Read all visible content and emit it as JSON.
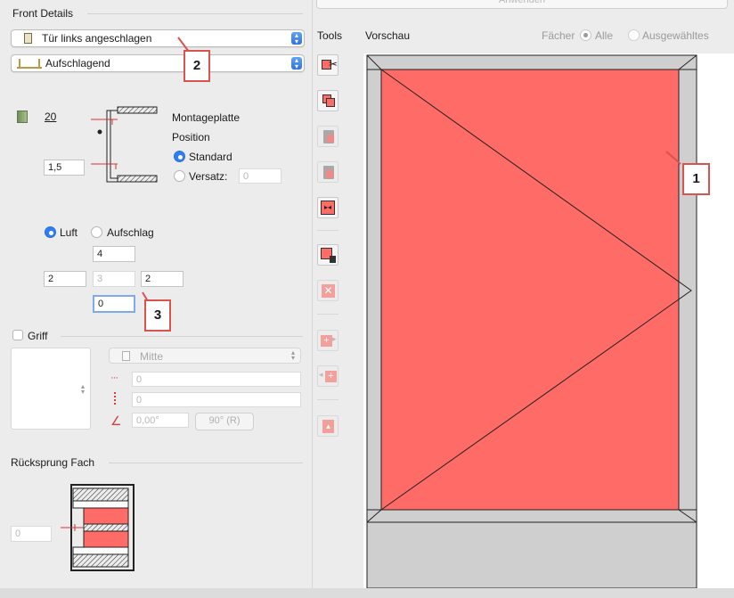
{
  "front_details": {
    "title": "Front Details",
    "door_select": "Tür links angeschlagen",
    "mount_select": "Aufschlagend",
    "thickness_value": "20",
    "offset_value": "1,5",
    "mounting_plate_label": "Montageplatte",
    "position_label": "Position",
    "standard_label": "Standard",
    "versatz_label": "Versatz:",
    "versatz_value": "0",
    "luft_label": "Luft",
    "aufschlag_label": "Aufschlag",
    "gap_top": "4",
    "gap_left": "2",
    "gap_center": "3",
    "gap_right": "2",
    "gap_bottom": "0"
  },
  "griff": {
    "label": "Griff",
    "position_select": "Mitte",
    "field_h": "0",
    "field_v": "0",
    "angle_value": "0,00°",
    "rotate_button": "90° (R)"
  },
  "ruecksprung": {
    "title": "Rücksprung Fach",
    "value": "0"
  },
  "tools": {
    "title": "Tools"
  },
  "preview": {
    "title": "Vorschau",
    "faecher_label": "Fächer",
    "alle_label": "Alle",
    "ausgewaehltes_label": "Ausgewähltes",
    "anwenden_button": "Anwenden",
    "door_fill": "#ff6b66"
  },
  "annotations": {
    "callout_1": "1",
    "callout_2": "2",
    "callout_3": "3"
  },
  "colors": {
    "accent": "#2f7df6",
    "door_red": "#ff6b66",
    "callout_border": "#d9534f"
  }
}
